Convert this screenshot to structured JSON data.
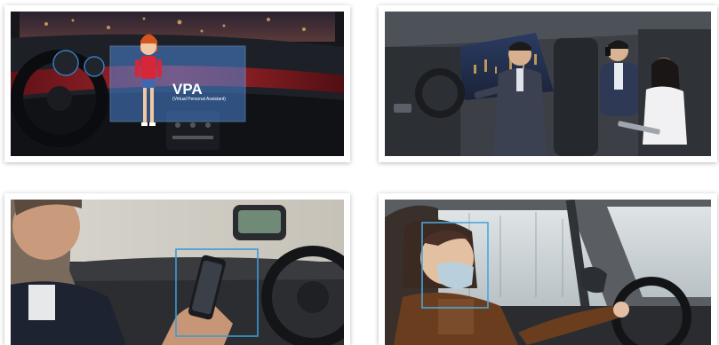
{
  "panels": [
    {
      "id": "vpa-dashboard",
      "overlay": {
        "title": "VPA",
        "subtitle": "(Virtual Personal Assistant)"
      },
      "colors": {
        "overlay": "#4b86d8",
        "dashboard": "#1b1e24",
        "ambient_light": "#b3222a"
      },
      "icons": [
        "avatar-character-icon",
        "steering-wheel-icon"
      ]
    },
    {
      "id": "cabin-occupants",
      "colors": {
        "interior": "#3c4046",
        "night_city": "#1f2a45"
      },
      "icons": [
        "driver-figure-icon",
        "passenger-figure-icon",
        "phone-passenger-figure-icon"
      ]
    },
    {
      "id": "phone-distraction",
      "colors": {
        "detection_box": "#3a9bd6",
        "window": "#d8d6cf"
      },
      "icons": [
        "phone-icon",
        "detection-frame-icon"
      ]
    },
    {
      "id": "masked-driver",
      "colors": {
        "detection_box": "#4aa6de",
        "snow_trees": "#c9d2d6",
        "jacket": "#6a3d1f"
      },
      "icons": [
        "face-mask-icon",
        "detection-frame-icon"
      ]
    }
  ]
}
